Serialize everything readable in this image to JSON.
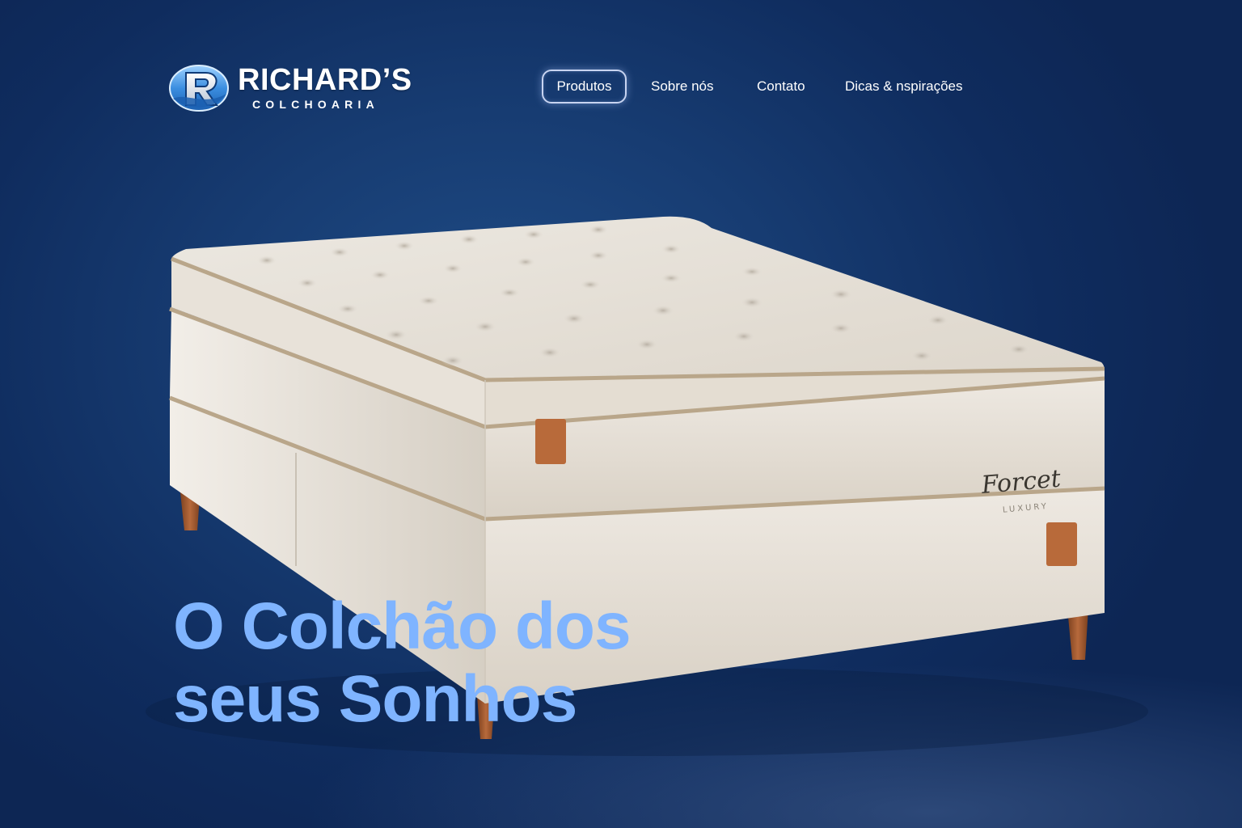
{
  "brand": {
    "name": "RICHARD’S",
    "subtitle": "COLCHOARIA",
    "monogram": "R"
  },
  "nav": {
    "items": [
      {
        "label": "Produtos",
        "active": true
      },
      {
        "label": "Sobre nós",
        "active": false
      },
      {
        "label": "Contato",
        "active": false
      },
      {
        "label": "Dicas & nspirações",
        "active": false
      }
    ]
  },
  "product": {
    "label_script": "Forcet",
    "label_small": "LUXURY"
  },
  "hero": {
    "line1": "O Colchão dos",
    "line2": "seus Sonhos"
  },
  "colors": {
    "background": "#173c72",
    "headline": "#7fb4ff",
    "mattress": "#e9e3da",
    "piping": "#b9a68a",
    "leather_tab": "#b86a3a",
    "legs": "#a05a32"
  }
}
